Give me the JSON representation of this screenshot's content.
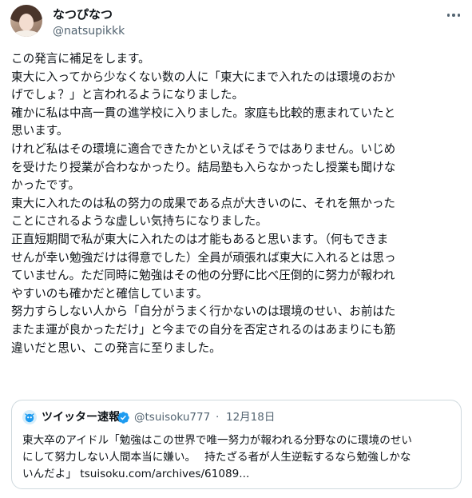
{
  "author": {
    "display_name": "なつぴなつ",
    "handle": "@natsupikkk",
    "avatar_icon": "profile-photo"
  },
  "tweet": {
    "lines": [
      "この発言に補足をします。",
      "東大に入ってから少なくない数の人に「東大にまで入れたのは環境のおか",
      "げでしょ？」と言われるようになりました。",
      "確かに私は中高一貫の進学校に入りました。家庭も比較的恵まれていたと",
      "思います。",
      "けれど私はその環境に適合できたかといえばそうではありません。いじめ",
      "を受けたり授業が合わなかったり。結局塾も入らなかったし授業も聞けな",
      "かったです。",
      "東大に入れたのは私の努力の成果である点が大きいのに、それを無かった",
      "ことにされるような虚しい気持ちになりました。",
      "正直短期間で私が東大に入れたのは才能もあると思います。（何もできま",
      "せんが幸い勉強だけは得意でした）全員が頑張れば東大に入れるとは思っ",
      "ていません。ただ同時に勉強はその他の分野に比べ圧倒的に努力が報われ",
      "やすいのも確かだと確信しています。",
      "努力すらしない人から「自分がうまく行かないのは環境のせい、お前はた",
      "またま運が良かっただけ」と今までの自分を否定されるのはあまりにも筋",
      "違いだと思い、この発言に至りました。"
    ]
  },
  "quoted_tweet": {
    "display_name": "ツイッター速報",
    "verified_icon": "verified-badge-icon",
    "handle": "@tsuisoku777",
    "separator": "·",
    "date": "12月18日",
    "lines": [
      "東大卒のアイドル「勉強はこの世界で唯一努力が報われる分野なのに環境のせい",
      "にして努力しない人間本当に嫌い。　 持たざる者が人生逆転するなら勉強しかな",
      "いんだよ」 tsuisoku.com/archives/61089..."
    ]
  },
  "colors": {
    "text": "#0f1419",
    "secondary": "#536471",
    "border": "#cfd9de",
    "verified": "#1d9bf0"
  }
}
